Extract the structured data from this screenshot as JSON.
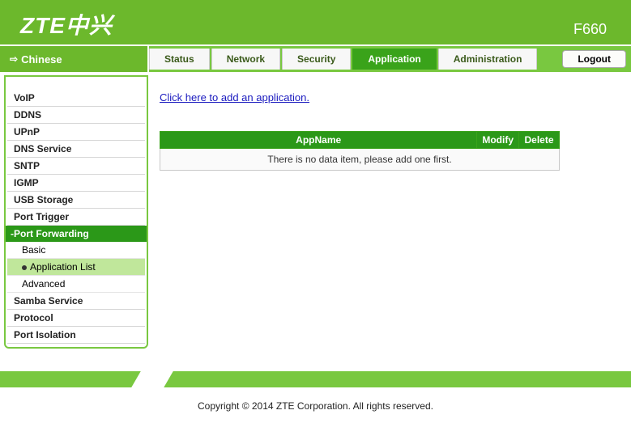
{
  "header": {
    "logo": "ZTE中兴",
    "model": "F660"
  },
  "lang": {
    "label": "Chinese"
  },
  "tabs": [
    {
      "label": "Status",
      "active": false
    },
    {
      "label": "Network",
      "active": false
    },
    {
      "label": "Security",
      "active": false
    },
    {
      "label": "Application",
      "active": true
    },
    {
      "label": "Administration",
      "active": false
    }
  ],
  "logout_label": "Logout",
  "sidebar": {
    "items": [
      "VoIP",
      "DDNS",
      "UPnP",
      "DNS Service",
      "SNTP",
      "IGMP",
      "USB Storage",
      "Port Trigger"
    ],
    "expanded": {
      "label": "-Port Forwarding",
      "sub": [
        {
          "label": "Basic",
          "selected": false
        },
        {
          "label": "Application List",
          "selected": true
        },
        {
          "label": "Advanced",
          "selected": false
        }
      ]
    },
    "after": [
      "Samba Service",
      "Protocol",
      "Port Isolation"
    ]
  },
  "content": {
    "add_link": "Click here to add an application.",
    "table": {
      "headers": [
        "AppName",
        "Modify",
        "Delete"
      ],
      "empty_text": "There is no data item, please add one first."
    }
  },
  "footer": {
    "copyright": "Copyright © 2014 ZTE Corporation. All rights reserved."
  }
}
